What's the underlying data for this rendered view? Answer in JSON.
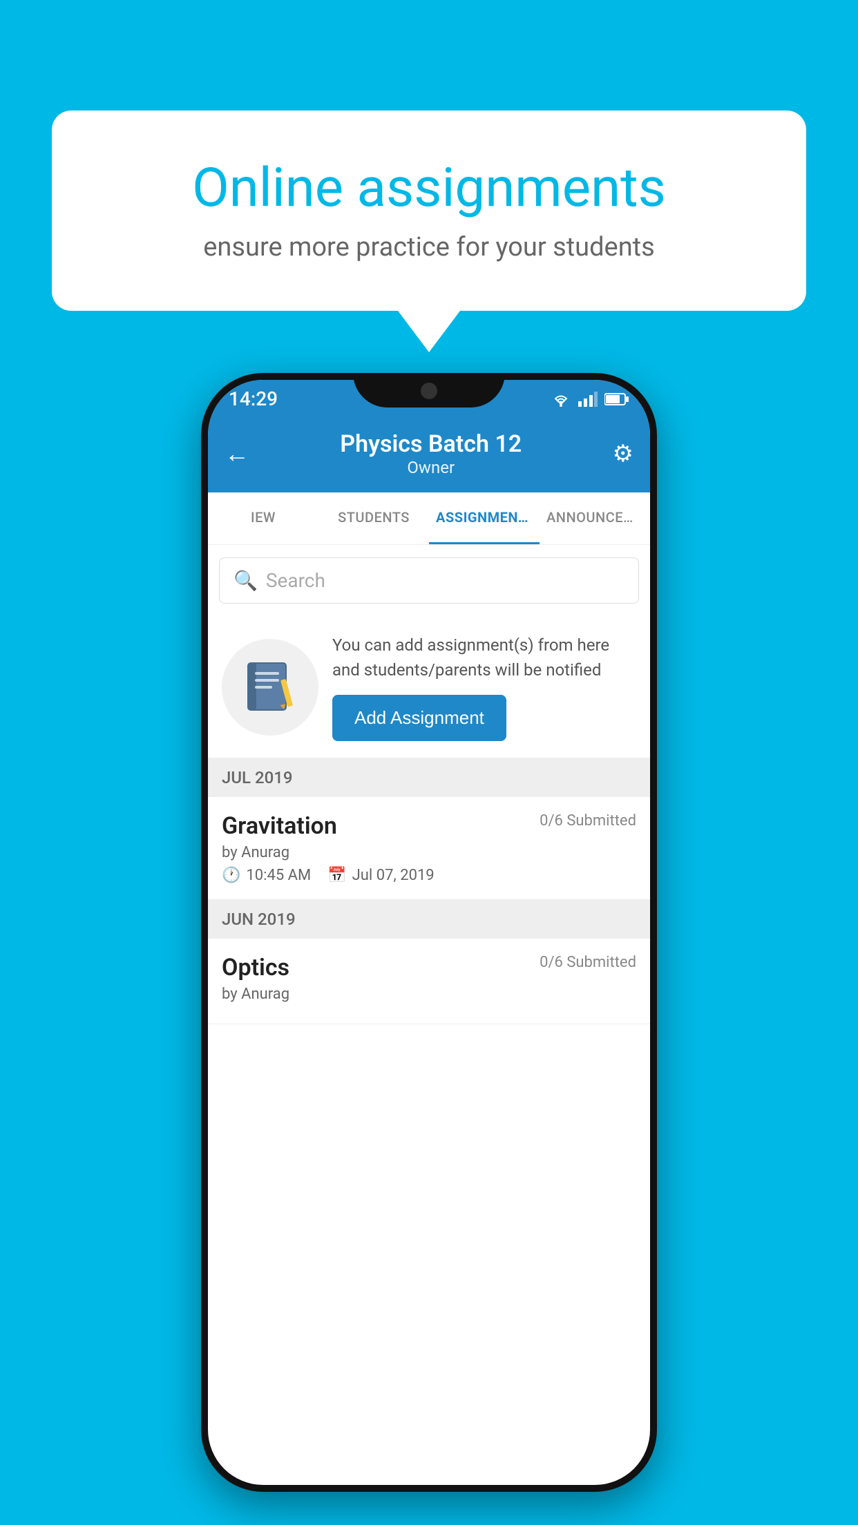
{
  "background": {
    "color": "#00B8E6"
  },
  "speech_bubble": {
    "title": "Online assignments",
    "subtitle": "ensure more practice for your students"
  },
  "status_bar": {
    "time": "14:29"
  },
  "header": {
    "title": "Physics Batch 12",
    "subtitle": "Owner",
    "back_label": "←",
    "gear_label": "⚙"
  },
  "tabs": [
    {
      "label": "IEW",
      "active": false
    },
    {
      "label": "STUDENTS",
      "active": false
    },
    {
      "label": "ASSIGNMENTS",
      "active": true
    },
    {
      "label": "ANNOUNCEM...",
      "active": false
    }
  ],
  "search": {
    "placeholder": "Search"
  },
  "promo": {
    "text": "You can add assignment(s) from here and students/parents will be notified",
    "button_label": "Add Assignment"
  },
  "sections": [
    {
      "month_label": "JUL 2019",
      "assignments": [
        {
          "name": "Gravitation",
          "status": "0/6 Submitted",
          "by": "by Anurag",
          "time": "10:45 AM",
          "date": "Jul 07, 2019"
        }
      ]
    },
    {
      "month_label": "JUN 2019",
      "assignments": [
        {
          "name": "Optics",
          "status": "0/6 Submitted",
          "by": "by Anurag",
          "time": "",
          "date": ""
        }
      ]
    }
  ]
}
